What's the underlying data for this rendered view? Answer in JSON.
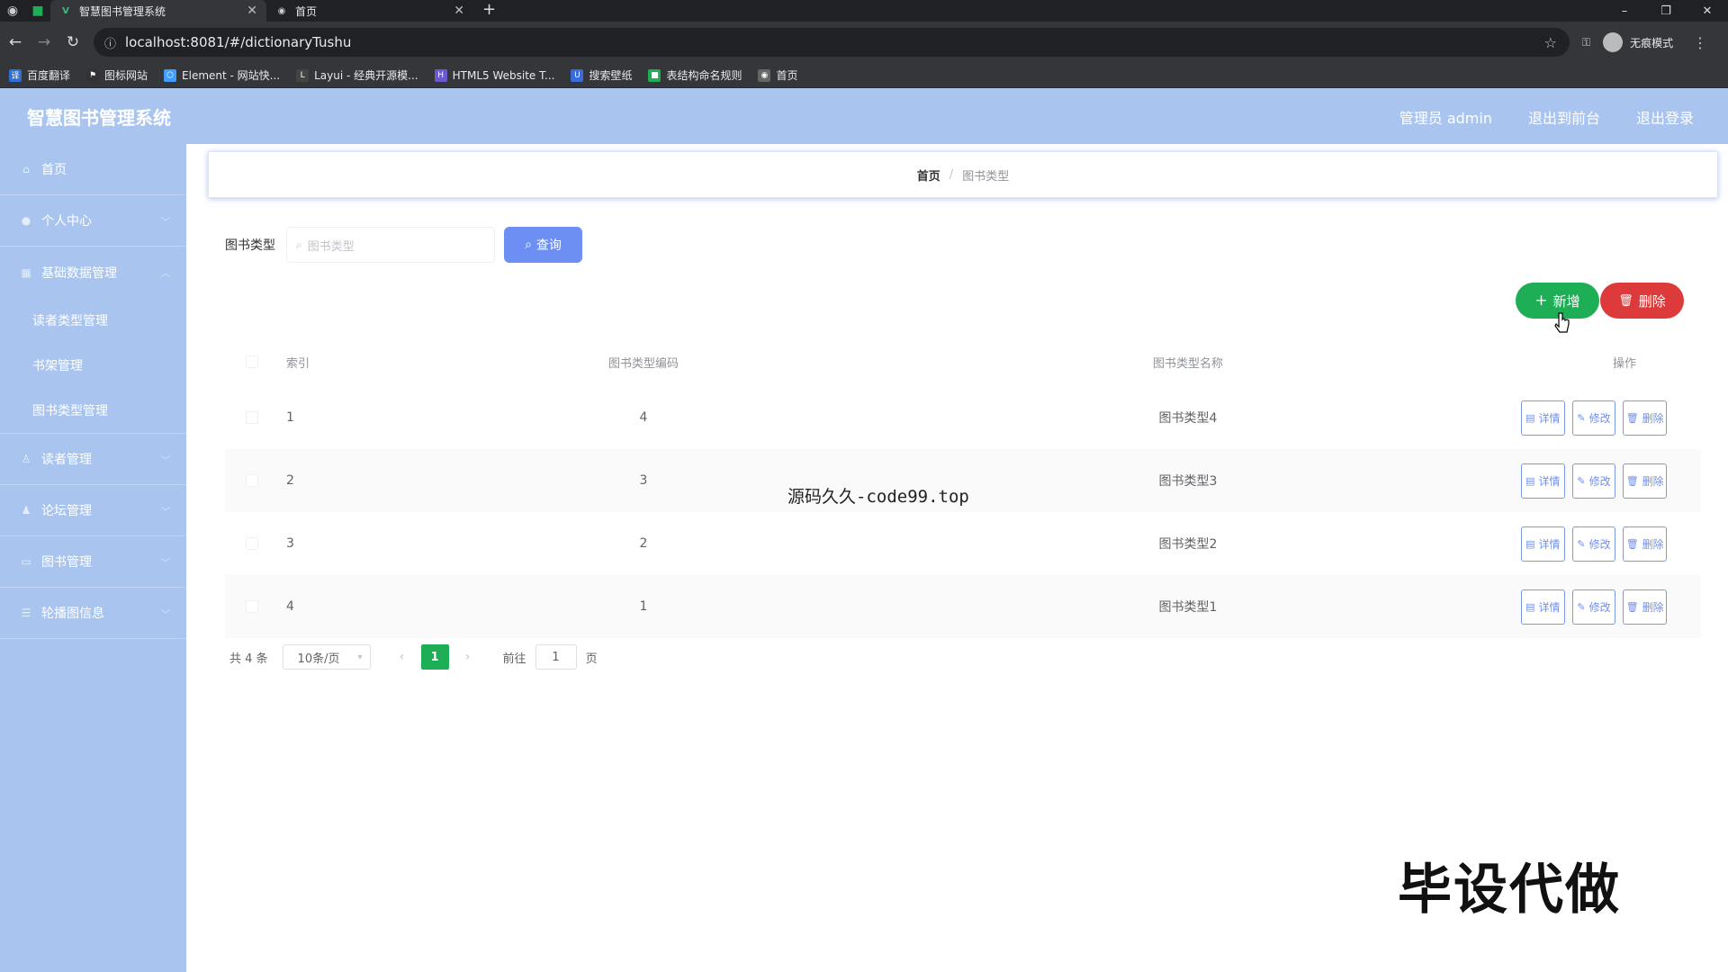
{
  "browser": {
    "tabs": [
      {
        "title": "智慧图书管理系统",
        "active": true
      },
      {
        "title": "首页",
        "active": false
      }
    ],
    "url": "localhost:8081/#/dictionaryTushu",
    "profile_label": "无痕模式",
    "bookmarks": [
      {
        "label": "百度翻译",
        "color": "#2f6fd8"
      },
      {
        "label": "图标网站",
        "color": "#333333"
      },
      {
        "label": "Element - 网站快...",
        "color": "#409eff"
      },
      {
        "label": "Layui - 经典开源模...",
        "color": "#444444"
      },
      {
        "label": "HTML5 Website T...",
        "color": "#6a5acd"
      },
      {
        "label": "搜索壁纸",
        "color": "#3b6bd8"
      },
      {
        "label": "表结构命名规则",
        "color": "#1eae56"
      },
      {
        "label": "首页",
        "color": "#666666"
      }
    ]
  },
  "header": {
    "title": "智慧图书管理系统",
    "admin_label": "管理员 admin",
    "back_label": "退出到前台",
    "logout_label": "退出登录"
  },
  "sidebar": {
    "items": [
      {
        "label": "首页",
        "icon": "home-icon"
      },
      {
        "label": "个人中心",
        "icon": "user-icon"
      },
      {
        "label": "基础数据管理",
        "icon": "grid-icon"
      },
      {
        "label": "读者管理",
        "icon": "reader-icon"
      },
      {
        "label": "论坛管理",
        "icon": "forum-icon"
      },
      {
        "label": "图书管理",
        "icon": "book-icon"
      },
      {
        "label": "轮播图信息",
        "icon": "list-icon"
      }
    ],
    "submenu": [
      {
        "label": "读者类型管理"
      },
      {
        "label": "书架管理"
      },
      {
        "label": "图书类型管理"
      }
    ]
  },
  "breadcrumb": {
    "home": "首页",
    "separator": "/",
    "current": "图书类型"
  },
  "search": {
    "label": "图书类型",
    "placeholder": "图书类型",
    "button": "查询"
  },
  "actions": {
    "add": "新增",
    "delete": "删除"
  },
  "table": {
    "headers": {
      "index": "索引",
      "code": "图书类型编码",
      "name": "图书类型名称",
      "ops": "操作"
    },
    "rows": [
      {
        "index": "1",
        "code": "4",
        "name": "图书类型4"
      },
      {
        "index": "2",
        "code": "3",
        "name": "图书类型3"
      },
      {
        "index": "3",
        "code": "2",
        "name": "图书类型2"
      },
      {
        "index": "4",
        "code": "1",
        "name": "图书类型1"
      }
    ],
    "op_labels": {
      "detail": "详情",
      "edit": "修改",
      "delete": "删除"
    }
  },
  "pagination": {
    "total": "共 4 条",
    "page_size": "10条/页",
    "current_page": "1",
    "goto_prefix": "前往",
    "goto_value": "1",
    "goto_suffix": "页"
  },
  "watermarks": {
    "center": "源码久久-code99.top",
    "corner": "毕设代做"
  },
  "colors": {
    "header_bg": "#a9c5ef",
    "primary": "#6d8ff3",
    "success": "#1eae56",
    "danger": "#dd3b3b"
  }
}
